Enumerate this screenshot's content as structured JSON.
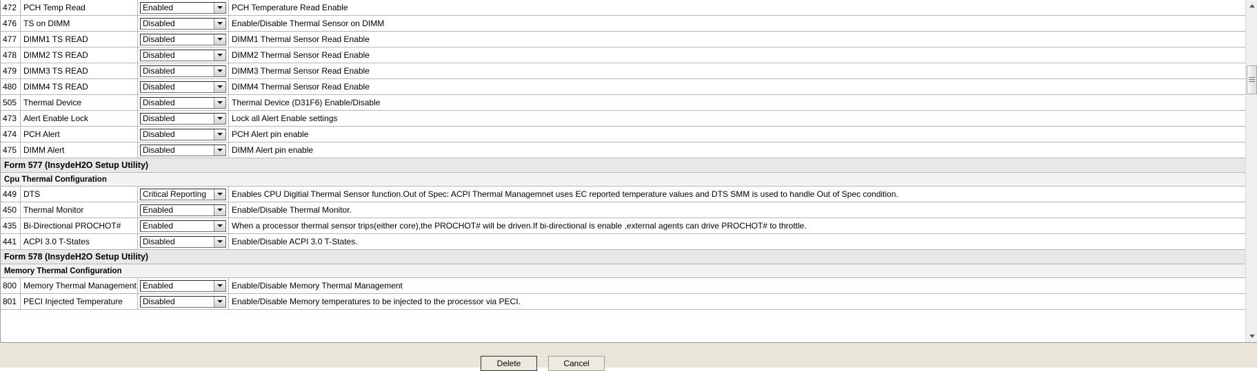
{
  "rows": [
    {
      "kind": "item",
      "id": "472",
      "name": "PCH Temp Read",
      "value": "Enabled",
      "desc": "PCH Temperature Read Enable"
    },
    {
      "kind": "item",
      "id": "476",
      "name": "TS on DIMM",
      "value": "Disabled",
      "desc": "Enable/Disable Thermal Sensor on DIMM"
    },
    {
      "kind": "item",
      "id": "477",
      "name": "DIMM1 TS READ",
      "value": "Disabled",
      "desc": "DIMM1 Thermal Sensor Read Enable"
    },
    {
      "kind": "item",
      "id": "478",
      "name": "DIMM2 TS READ",
      "value": "Disabled",
      "desc": "DIMM2 Thermal Sensor Read Enable"
    },
    {
      "kind": "item",
      "id": "479",
      "name": "DIMM3 TS READ",
      "value": "Disabled",
      "desc": "DIMM3 Thermal Sensor Read Enable"
    },
    {
      "kind": "item",
      "id": "480",
      "name": "DIMM4 TS READ",
      "value": "Disabled",
      "desc": "DIMM4 Thermal Sensor Read Enable"
    },
    {
      "kind": "item",
      "id": "505",
      "name": "Thermal Device",
      "value": "Disabled",
      "desc": "Thermal Device (D31F6) Enable/Disable"
    },
    {
      "kind": "item",
      "id": "473",
      "name": "Alert Enable Lock",
      "value": "Disabled",
      "desc": "Lock all Alert Enable settings"
    },
    {
      "kind": "item",
      "id": "474",
      "name": "PCH Alert",
      "value": "Disabled",
      "desc": "PCH Alert pin enable"
    },
    {
      "kind": "item",
      "id": "475",
      "name": "DIMM Alert",
      "value": "Disabled",
      "desc": "DIMM Alert pin enable"
    },
    {
      "kind": "form",
      "title": "Form 577 (InsydeH2O Setup Utility)"
    },
    {
      "kind": "sub",
      "title": "Cpu Thermal Configuration"
    },
    {
      "kind": "item",
      "id": "449",
      "name": "DTS",
      "value": "Critical Reporting",
      "desc": "Enables CPU Digitial Thermal Sensor function.Out of Spec: ACPI Thermal Managemnet uses EC reported temperature values and DTS SMM is used to handle Out of Spec condition."
    },
    {
      "kind": "item",
      "id": "450",
      "name": "Thermal Monitor",
      "value": "Enabled",
      "desc": "Enable/Disable Thermal Monitor."
    },
    {
      "kind": "item",
      "id": "435",
      "name": "Bi-Directional PROCHOT#",
      "value": "Enabled",
      "desc": "When a processor thermal sensor trips(either core),the PROCHOT# will be driven.If bi-directional is enable ,external agents can drive PROCHOT# to throttle."
    },
    {
      "kind": "item",
      "id": "441",
      "name": "ACPI 3.0 T-States",
      "value": "Disabled",
      "desc": "Enable/Disable ACPI 3.0 T-States."
    },
    {
      "kind": "form",
      "title": "Form 578 (InsydeH2O Setup Utility)"
    },
    {
      "kind": "sub",
      "title": "Memory Thermal Configuration"
    },
    {
      "kind": "item",
      "id": "800",
      "name": "Memory Thermal Management",
      "value": "Enabled",
      "desc": "Enable/Disable Memory Thermal Management"
    },
    {
      "kind": "item",
      "id": "801",
      "name": "PECI Injected Temperature",
      "value": "Disabled",
      "desc": "Enable/Disable Memory temperatures to be injected to the processor via PECI."
    }
  ],
  "footer": {
    "delete_label": "Delete",
    "cancel_label": "Cancel"
  },
  "scrollbar": {
    "up_icon": "triangle-up-icon",
    "down_icon": "triangle-down-icon",
    "thumb_icon": "scroll-thumb-grip"
  }
}
